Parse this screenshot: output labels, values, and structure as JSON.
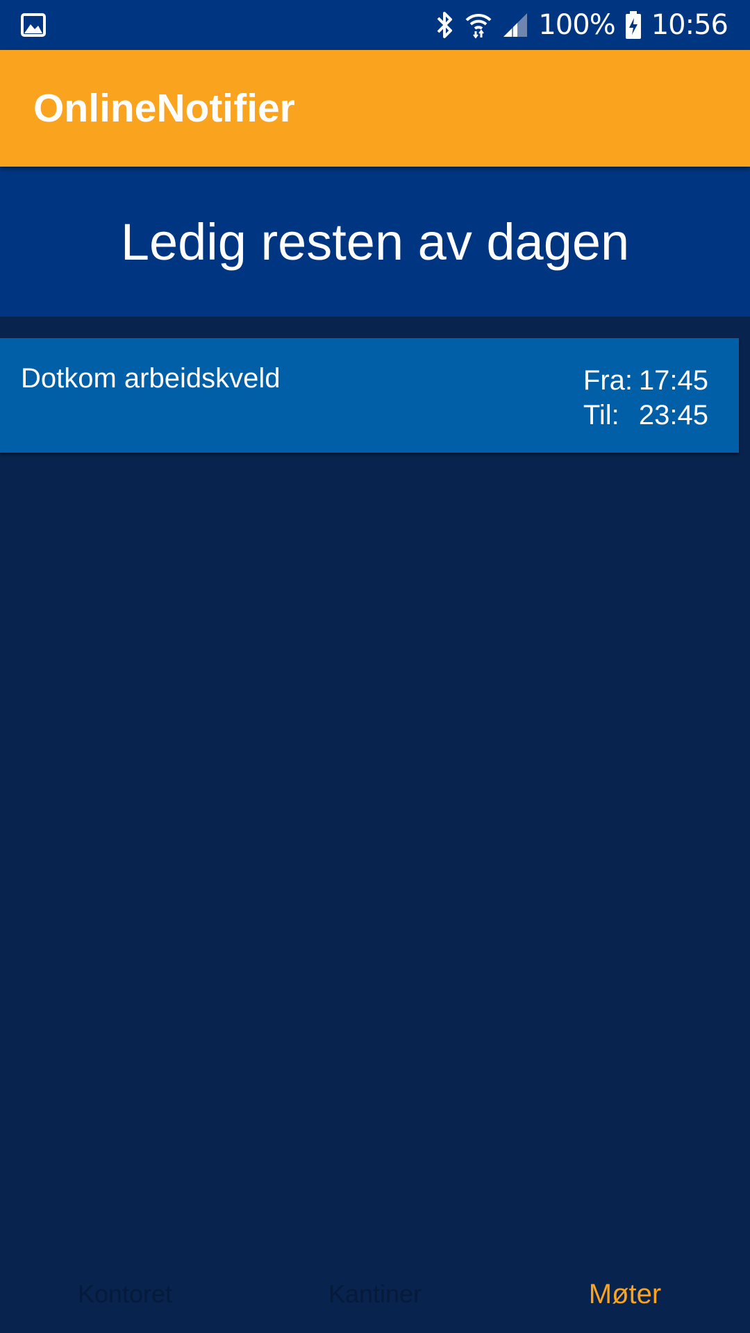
{
  "status_bar": {
    "notification_icon": "gallery-icon",
    "bluetooth_icon": "bluetooth-icon",
    "wifi_icon": "wifi-icon",
    "signal_icon": "signal-icon",
    "battery_percent": "100%",
    "battery_icon": "battery-charging-icon",
    "time": "10:56"
  },
  "app_bar": {
    "title": "OnlineNotifier"
  },
  "banner": {
    "text": "Ledig resten av dagen"
  },
  "meetings": [
    {
      "title": "Dotkom arbeidskveld",
      "from_label": "Fra:",
      "from_time": "17:45",
      "to_label": "Til:",
      "to_time": "23:45"
    }
  ],
  "bottom_nav": {
    "tabs": [
      {
        "label": "Kontoret",
        "active": false
      },
      {
        "label": "Kantiner",
        "active": false
      },
      {
        "label": "Møter",
        "active": true
      }
    ]
  },
  "colors": {
    "status_bar": "#003681",
    "app_bar": "#f9a31f",
    "background": "#08234d",
    "banner": "#003681",
    "card": "#005fa6",
    "active_tab": "#f9a31f",
    "inactive_tab": "#061a3a"
  }
}
